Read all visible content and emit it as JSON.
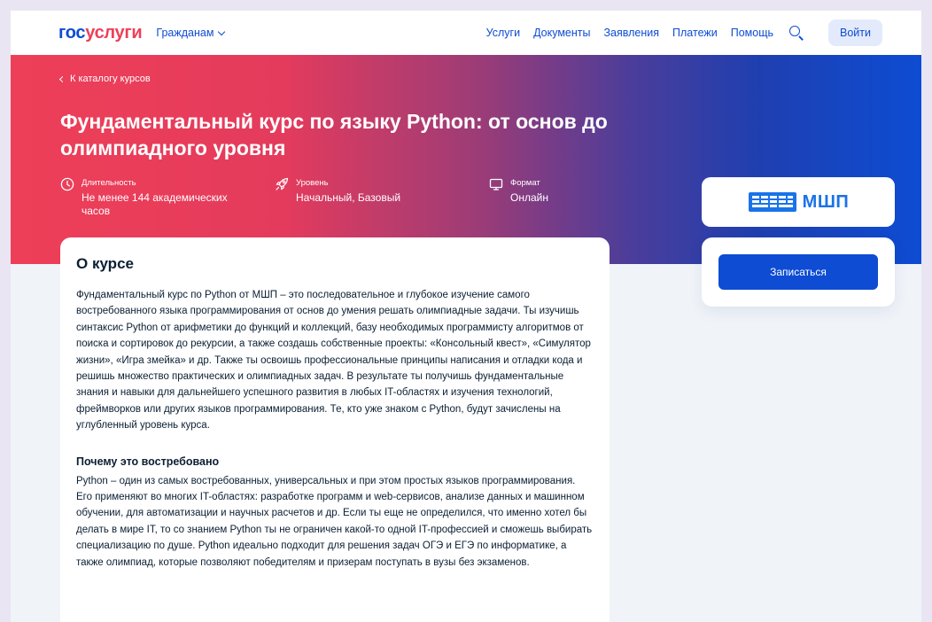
{
  "header": {
    "logo_part1": "гос",
    "logo_part2": "услуги",
    "audience": "Гражданам",
    "nav": [
      "Услуги",
      "Документы",
      "Заявления",
      "Платежи",
      "Помощь"
    ],
    "login": "Войти"
  },
  "hero": {
    "back_link": "К каталогу курсов",
    "title": "Фундаментальный курс по языку Python: от основ до олимпиадного уровня",
    "duration": {
      "label": "Длительность",
      "value": "Не менее 144 академических часов"
    },
    "level": {
      "label": "Уровень",
      "value": "Начальный, Базовый"
    },
    "format": {
      "label": "Формат",
      "value": "Онлайн"
    }
  },
  "about": {
    "heading": "О курсе",
    "text": "Фундаментальный курс по Python от МШП – это последовательное и глубокое изучение самого востребованного языка программирования от основ до умения решать олимпиадные задачи. Ты изучишь синтаксис Python от арифметики до функций и коллекций, базу необходимых программисту алгоритмов от поиска и сортировок до рекурсии, а также создашь собственные проекты: «Консольный квест», «Симулятор жизни», «Игра змейка» и др. Также ты освоишь профессиональные принципы написания и отладки кода и решишь множество практических и олимпиадных задач. В результате ты получишь фундаментальные знания и навыки для дальнейшего успешного развития в любых IT-областях и изучения технологий, фреймворков или других языков программирования. Те, кто уже знаком с Python, будут зачислены на углубленный уровень курса.",
    "why_heading": "Почему это востребовано",
    "why_text": "Python – один из самых востребованных, универсальных и при этом простых языков программирования. Его применяют во многих IT-областях: разработке программ и web-сервисов, анализе данных и машинном обучении, для автоматизации и научных расчетов и др. Если ты еще не определился, что именно хотел бы делать в мире IT, то со знанием Python ты не ограничен какой-то одной IT-профессией и сможешь выбирать специализацию по душе. Python идеально подходит для решения задач ОГЭ и ЕГЭ по информатике, а также олимпиад, которые позволяют победителям и призерам поступать в вузы без экзаменов."
  },
  "sidebar": {
    "org_name": "МШП",
    "enroll": "Записаться"
  },
  "colors": {
    "brand_blue": "#0d4cd3",
    "brand_red": "#ee3f58",
    "logo_blue": "#1a73e8"
  },
  "icons": [
    "chevron-down-icon",
    "search-icon",
    "chevron-left-icon",
    "clock-icon",
    "rocket-icon",
    "monitor-icon",
    "org-logo-icon"
  ]
}
